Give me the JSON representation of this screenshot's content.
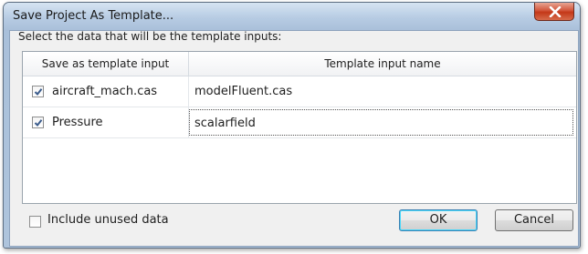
{
  "dialog": {
    "title": "Save Project As Template...",
    "prompt": "Select the data that will be the template inputs:"
  },
  "table": {
    "columns": [
      "Save as template input",
      "Template input name"
    ],
    "rows": [
      {
        "source": "aircraft_mach.cas",
        "checked": true,
        "name": "modelFluent.cas"
      },
      {
        "source": "Pressure",
        "checked": true,
        "name": "scalarfield"
      }
    ]
  },
  "footer": {
    "include_unused_label": "Include unused data",
    "include_unused_checked": false,
    "ok_label": "OK",
    "cancel_label": "Cancel"
  },
  "icons": {
    "close": "close-icon",
    "check": "checkmark-icon"
  },
  "colors": {
    "title_bar": "#b6cbe3",
    "close_button": "#c43818",
    "default_button_border": "#3c7fb1"
  }
}
